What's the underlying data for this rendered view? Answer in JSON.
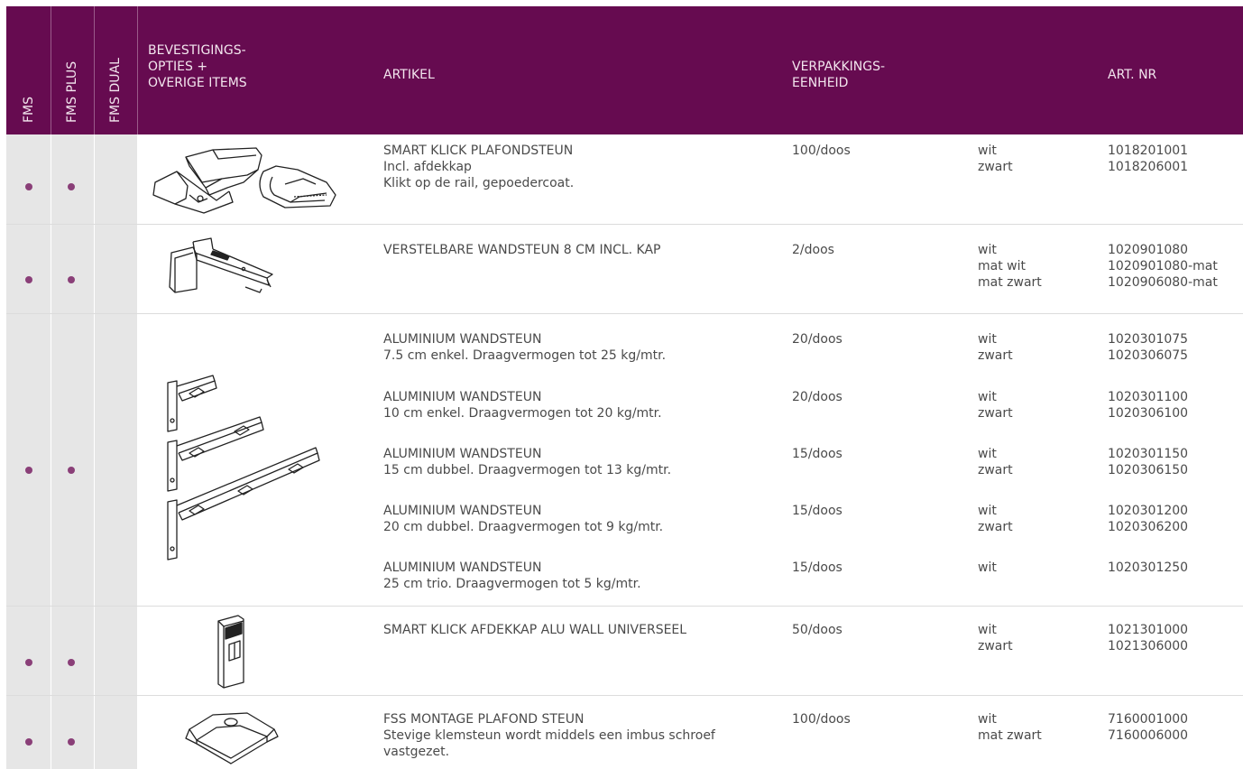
{
  "header": {
    "col_fms": "FMS",
    "col_fms_plus": "FMS PLUS",
    "col_fms_dual": "FMS DUAL",
    "col_options": [
      "BEVESTIGINGS-",
      "OPTIES +",
      "OVERIGE ITEMS"
    ],
    "col_article": "ARTIKEL",
    "col_packaging": [
      "VERPAKKINGS-",
      "EENHEID"
    ],
    "col_art_nr": "ART. NR"
  },
  "rows": [
    {
      "fms": true,
      "fms_plus": true,
      "fms_dual": false,
      "image": "smart-klick-ceiling-bracket-icon",
      "items": [
        {
          "article": [
            "SMART KLICK PLAFONDSTEUN",
            "Incl. afdekkap",
            "Klikt op de rail, gepoedercoat."
          ],
          "packaging": "100/doos",
          "colors": [
            "wit",
            "zwart"
          ],
          "art_nrs": [
            "1018201001",
            "1018206001"
          ]
        }
      ]
    },
    {
      "fms": true,
      "fms_plus": true,
      "fms_dual": false,
      "image": "adjustable-wall-bracket-icon",
      "items": [
        {
          "article": [
            "VERSTELBARE WANDSTEUN 8 CM INCL. KAP"
          ],
          "packaging": "2/doos",
          "colors": [
            "wit",
            "mat wit",
            "mat zwart"
          ],
          "art_nrs": [
            "1020901080",
            "1020901080-mat",
            "1020906080-mat"
          ]
        }
      ]
    },
    {
      "fms": true,
      "fms_plus": true,
      "fms_dual": false,
      "image": "aluminium-wall-brackets-icon",
      "items": [
        {
          "article": [
            "ALUMINIUM WANDSTEUN",
            "7.5 cm enkel. Draagvermogen tot 25 kg/mtr."
          ],
          "packaging": "20/doos",
          "colors": [
            "wit",
            "zwart"
          ],
          "art_nrs": [
            "1020301075",
            "1020306075"
          ]
        },
        {
          "article": [
            "ALUMINIUM WANDSTEUN",
            "10 cm enkel. Draagvermogen tot 20 kg/mtr."
          ],
          "packaging": "20/doos",
          "colors": [
            "wit",
            "zwart"
          ],
          "art_nrs": [
            "1020301100",
            "1020306100"
          ]
        },
        {
          "article": [
            "ALUMINIUM WANDSTEUN",
            "15 cm dubbel. Draagvermogen tot 13 kg/mtr."
          ],
          "packaging": "15/doos",
          "colors": [
            "wit",
            "zwart"
          ],
          "art_nrs": [
            "1020301150",
            "1020306150"
          ]
        },
        {
          "article": [
            "ALUMINIUM WANDSTEUN",
            "20 cm dubbel. Draagvermogen tot 9 kg/mtr."
          ],
          "packaging": "15/doos",
          "colors": [
            "wit",
            "zwart"
          ],
          "art_nrs": [
            "1020301200",
            "1020306200"
          ]
        },
        {
          "article": [
            "ALUMINIUM WANDSTEUN",
            "25 cm trio. Draagvermogen tot 5 kg/mtr."
          ],
          "packaging": "15/doos",
          "colors": [
            "wit"
          ],
          "art_nrs": [
            "1020301250"
          ]
        }
      ]
    },
    {
      "fms": true,
      "fms_plus": true,
      "fms_dual": false,
      "image": "smart-klick-cover-cap-icon",
      "items": [
        {
          "article": [
            "SMART KLICK AFDEKKAP ALU WALL UNIVERSEEL"
          ],
          "packaging": "50/doos",
          "colors": [
            "wit",
            "zwart"
          ],
          "art_nrs": [
            "1021301000",
            "1021306000"
          ]
        }
      ]
    },
    {
      "fms": true,
      "fms_plus": true,
      "fms_dual": false,
      "image": "fss-ceiling-clamp-icon",
      "items": [
        {
          "article": [
            "FSS MONTAGE PLAFOND STEUN",
            "Stevige klemsteun wordt middels een imbus schroef",
            "vastgezet."
          ],
          "packaging": "100/doos",
          "colors": [
            "wit",
            "mat zwart"
          ],
          "art_nrs": [
            "7160001000",
            "7160006000"
          ]
        }
      ]
    }
  ],
  "colors": {
    "header_bg": "#660b50",
    "dot": "#8a3f78",
    "check_bg": "#e6e6e6"
  }
}
